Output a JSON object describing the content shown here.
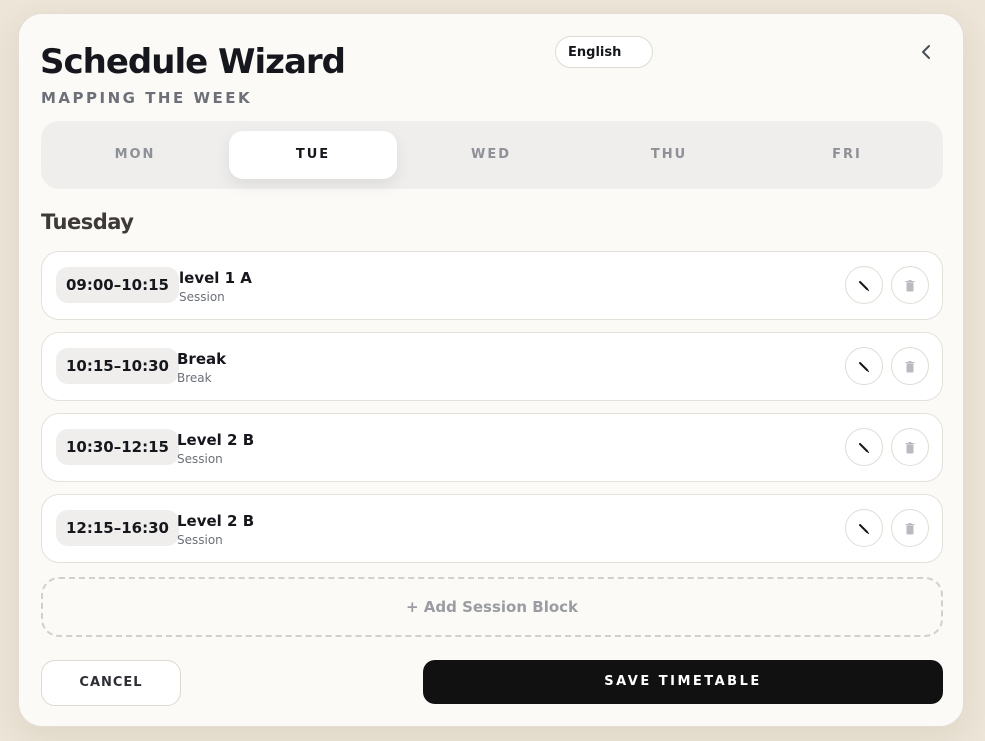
{
  "header": {
    "title": "Schedule Wizard",
    "subtitle": "MAPPING THE WEEK",
    "language": "English",
    "back_icon": "chevron-left-icon"
  },
  "tabs": [
    {
      "label": "MON",
      "active": false
    },
    {
      "label": "TUE",
      "active": true
    },
    {
      "label": "WED",
      "active": false
    },
    {
      "label": "THU",
      "active": false
    },
    {
      "label": "FRI",
      "active": false
    }
  ],
  "day_heading": "Tuesday",
  "sessions": [
    {
      "time": "09:00–10:15",
      "name": "level 1 A",
      "type": "Session"
    },
    {
      "time": "10:15–10:30",
      "name": "Break",
      "type": "Break"
    },
    {
      "time": "10:30–12:15",
      "name": "Level 2 B",
      "type": "Session"
    },
    {
      "time": "12:15–16:30",
      "name": "Level 2 B",
      "type": "Session"
    }
  ],
  "add_button": "+ Add Session Block",
  "footer": {
    "cancel_label": "CANCEL",
    "save_label": "SAVE TIMETABLE"
  },
  "colors": {
    "background": "#ece5d8",
    "card": "#fbfaf7",
    "primary": "#111111",
    "muted": "#8e9097"
  }
}
